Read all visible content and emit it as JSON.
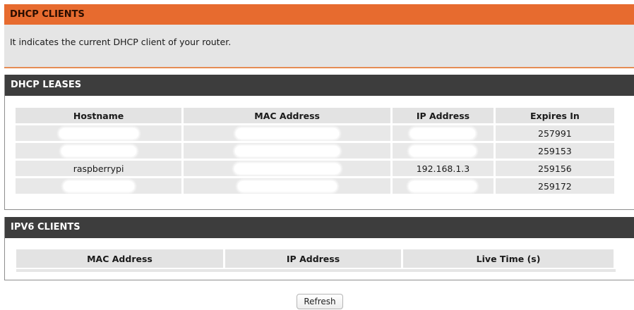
{
  "dhcp_clients": {
    "title": "DHCP CLIENTS",
    "description": "It indicates the current DHCP client of your router."
  },
  "dhcp_leases": {
    "title": "DHCP LEASES",
    "columns": [
      "Hostname",
      "MAC Address",
      "IP Address",
      "Expires In"
    ],
    "rows": [
      {
        "hostname": "",
        "mac": "",
        "ip": "",
        "expires": "257991"
      },
      {
        "hostname": "",
        "mac": "",
        "ip": "",
        "expires": "259153"
      },
      {
        "hostname": "raspberrypi",
        "mac": "",
        "ip": "192.168.1.3",
        "expires": "259156"
      },
      {
        "hostname": "",
        "mac": "",
        "ip": "",
        "expires": "259172"
      }
    ]
  },
  "ipv6_clients": {
    "title": "IPV6 CLIENTS",
    "columns": [
      "MAC Address",
      "IP Address",
      "Live Time (s)"
    ]
  },
  "buttons": {
    "refresh": "Refresh"
  },
  "colors": {
    "orange_header": "#e76b2f",
    "dark_header": "#3d3d3d",
    "panel_gray": "#e5e5e5",
    "cell_gray": "#e8e8e8"
  }
}
